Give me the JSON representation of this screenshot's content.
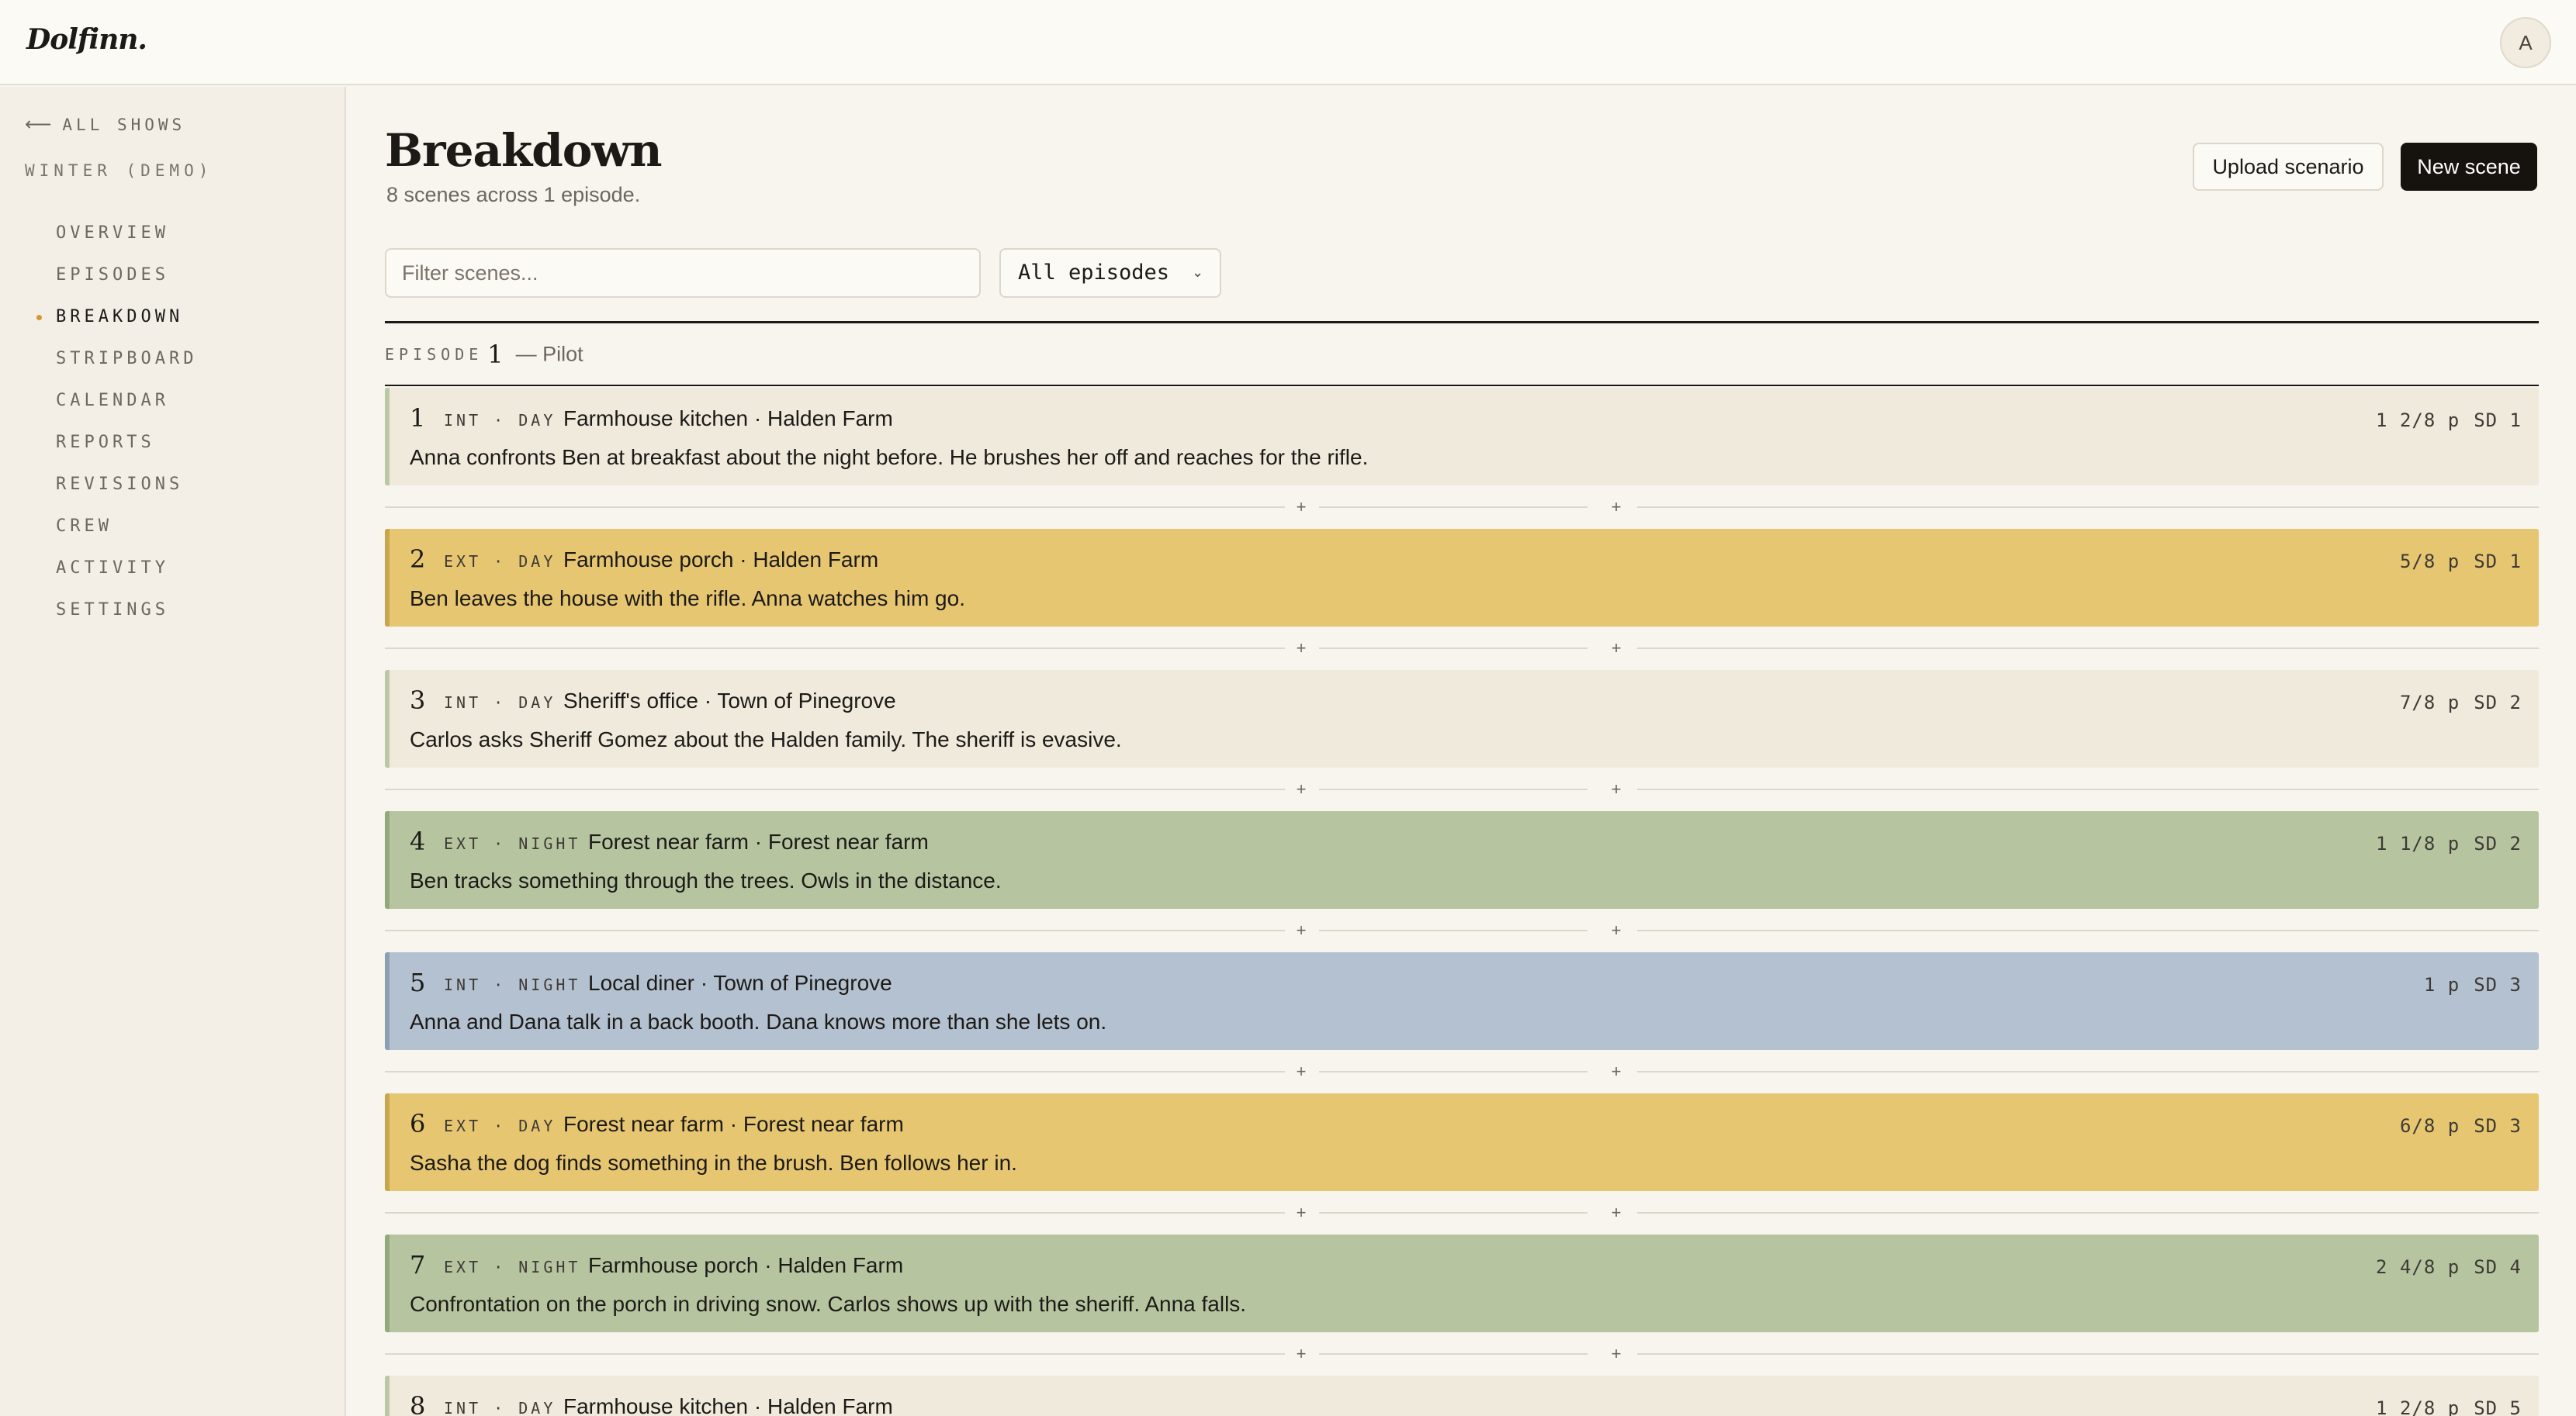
{
  "app": {
    "logo": "Dolfinn.",
    "avatar_initial": "A"
  },
  "sidebar": {
    "back_label": "ALL SHOWS",
    "show_name": "WINTER (DEMO)",
    "items": [
      {
        "label": "OVERVIEW",
        "active": false
      },
      {
        "label": "EPISODES",
        "active": false
      },
      {
        "label": "BREAKDOWN",
        "active": true
      },
      {
        "label": "STRIPBOARD",
        "active": false
      },
      {
        "label": "CALENDAR",
        "active": false
      },
      {
        "label": "REPORTS",
        "active": false
      },
      {
        "label": "REVISIONS",
        "active": false
      },
      {
        "label": "CREW",
        "active": false
      },
      {
        "label": "ACTIVITY",
        "active": false
      },
      {
        "label": "SETTINGS",
        "active": false
      }
    ]
  },
  "header": {
    "title": "Breakdown",
    "subtitle": "8 scenes across 1 episode.",
    "upload_label": "Upload scenario",
    "new_scene_label": "New scene"
  },
  "filters": {
    "search_placeholder": "Filter scenes...",
    "episode_selected": "All episodes"
  },
  "episode": {
    "label": "EPISODE",
    "number": "1",
    "name": "— Pilot"
  },
  "colors": {
    "int_day": "#f0eadd",
    "int_day_border": "#b9c8a6",
    "ext_day": "#e7c672",
    "ext_day_border": "#c9a64e",
    "ext_night": "#b6c5a0",
    "ext_night_border": "#93a87c",
    "int_night": "#b4c1d0",
    "int_night_border": "#8e9fb4"
  },
  "scenes": [
    {
      "number": "1",
      "slug": "INT · DAY",
      "location": "Farmhouse kitchen · Halden Farm",
      "description": "Anna confronts Ben at breakfast about the night before. He brushes her off and reaches for the rifle.",
      "pages": "1 2/8 p",
      "story_day": "SD 1",
      "type": "int_day"
    },
    {
      "number": "2",
      "slug": "EXT · DAY",
      "location": "Farmhouse porch · Halden Farm",
      "description": "Ben leaves the house with the rifle. Anna watches him go.",
      "pages": "5/8 p",
      "story_day": "SD 1",
      "type": "ext_day"
    },
    {
      "number": "3",
      "slug": "INT · DAY",
      "location": "Sheriff's office · Town of Pinegrove",
      "description": "Carlos asks Sheriff Gomez about the Halden family. The sheriff is evasive.",
      "pages": "7/8 p",
      "story_day": "SD 2",
      "type": "int_day"
    },
    {
      "number": "4",
      "slug": "EXT · NIGHT",
      "location": "Forest near farm · Forest near farm",
      "description": "Ben tracks something through the trees. Owls in the distance.",
      "pages": "1 1/8 p",
      "story_day": "SD 2",
      "type": "ext_night"
    },
    {
      "number": "5",
      "slug": "INT · NIGHT",
      "location": "Local diner · Town of Pinegrove",
      "description": "Anna and Dana talk in a back booth. Dana knows more than she lets on.",
      "pages": "1 p",
      "story_day": "SD 3",
      "type": "int_night"
    },
    {
      "number": "6",
      "slug": "EXT · DAY",
      "location": "Forest near farm · Forest near farm",
      "description": "Sasha the dog finds something in the brush. Ben follows her in.",
      "pages": "6/8 p",
      "story_day": "SD 3",
      "type": "ext_day"
    },
    {
      "number": "7",
      "slug": "EXT · NIGHT",
      "location": "Farmhouse porch · Halden Farm",
      "description": "Confrontation on the porch in driving snow. Carlos shows up with the sheriff. Anna falls.",
      "pages": "2 4/8 p",
      "story_day": "SD 4",
      "type": "ext_night"
    },
    {
      "number": "8",
      "slug": "INT · DAY",
      "location": "Farmhouse kitchen · Halden Farm",
      "description": "",
      "pages": "1 2/8 p",
      "story_day": "SD 5",
      "type": "int_day"
    }
  ],
  "insert_symbol": "+"
}
